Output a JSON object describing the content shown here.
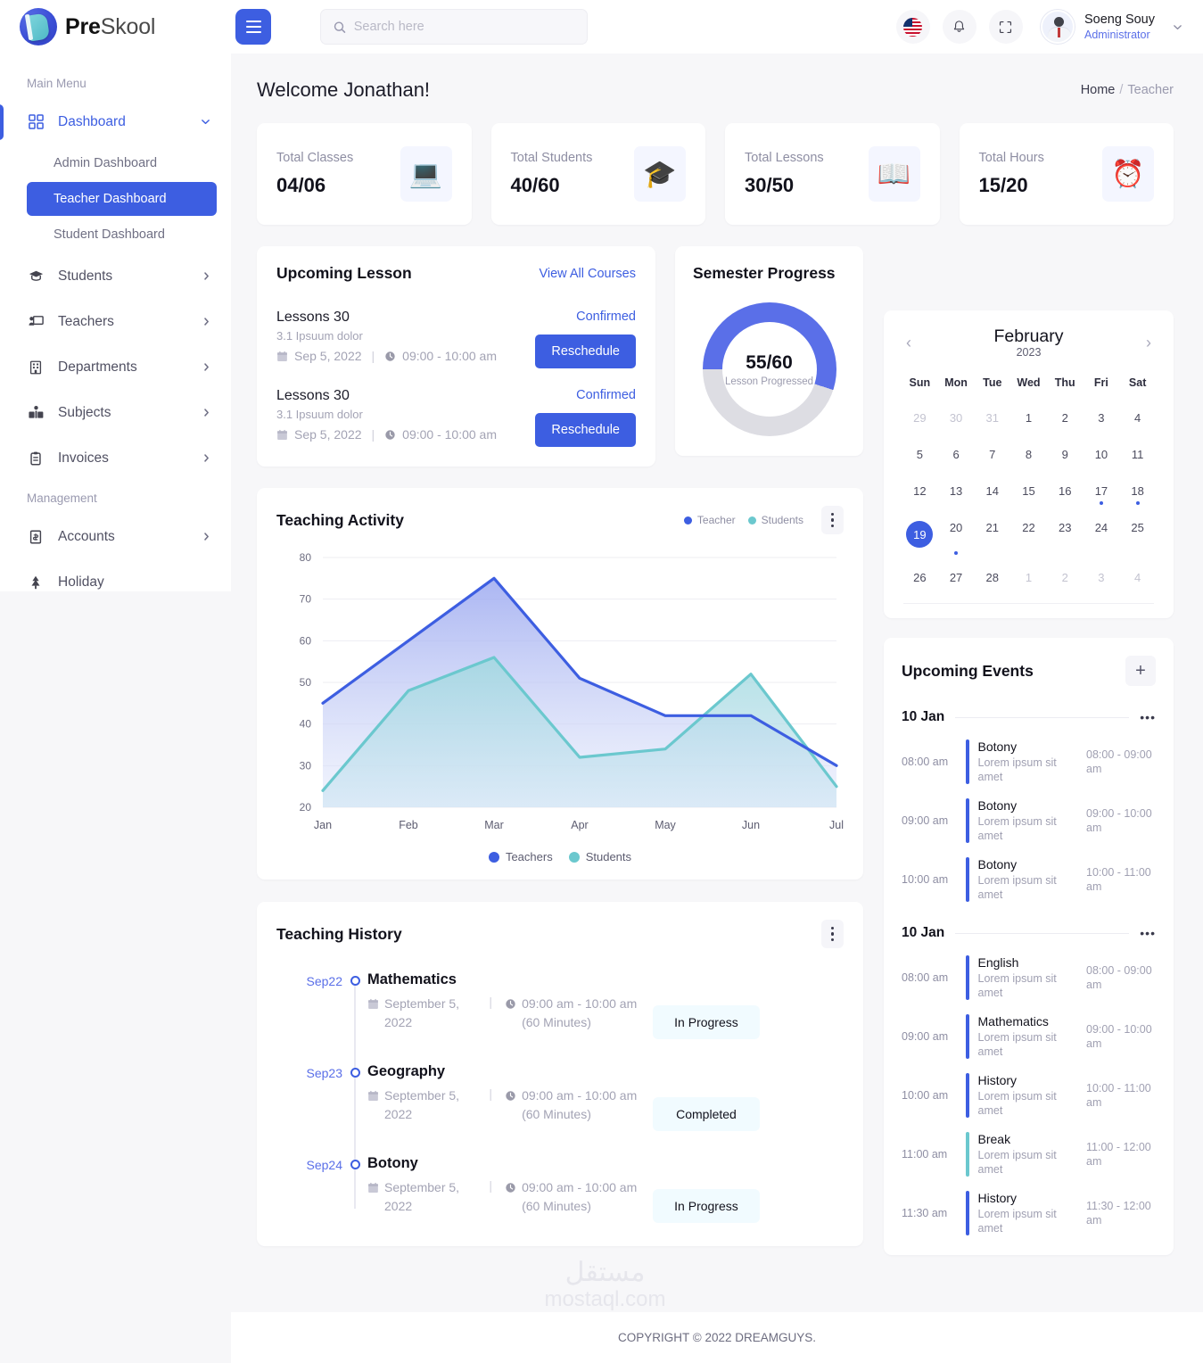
{
  "brand": {
    "pre": "Pre",
    "skool": "Skool"
  },
  "header": {
    "search_placeholder": "Search here",
    "search_value": "",
    "profile": {
      "name": "Soeng Souy",
      "role": "Administrator"
    },
    "icons": {
      "flag": "us-flag-icon",
      "bell": "bell-icon",
      "scan": "fullscreen-icon"
    }
  },
  "sidebar": {
    "main_label": "Main Menu",
    "management_label": "Management",
    "dashboard": {
      "label": "Dashboard"
    },
    "sub_items": [
      {
        "label": "Admin Dashboard",
        "selected": false
      },
      {
        "label": "Teacher Dashboard",
        "selected": true
      },
      {
        "label": "Student Dashboard",
        "selected": false
      }
    ],
    "items": [
      {
        "label": "Students"
      },
      {
        "label": "Teachers"
      },
      {
        "label": "Departments"
      },
      {
        "label": "Subjects"
      },
      {
        "label": "Invoices"
      }
    ],
    "management_items": [
      {
        "label": "Accounts"
      },
      {
        "label": "Holiday"
      }
    ]
  },
  "page": {
    "welcome": "Welcome Jonathan!",
    "breadcrumb": {
      "home": "Home",
      "sep": "/",
      "current": "Teacher"
    }
  },
  "stats": [
    {
      "title": "Total Classes",
      "value": "04/06",
      "icon": "💻"
    },
    {
      "title": "Total Students",
      "value": "40/60",
      "icon": "🎓"
    },
    {
      "title": "Total Lessons",
      "value": "30/50",
      "icon": "📖"
    },
    {
      "title": "Total Hours",
      "value": "15/20",
      "icon": "⏰"
    }
  ],
  "upcoming_lesson": {
    "title": "Upcoming Lesson",
    "view_all": "View All Courses",
    "lessons": [
      {
        "name": "Lessons 30",
        "sub": "3.1 Ipsuum dolor",
        "date": "Sep 5, 2022",
        "time": "09:00 - 10:00 am",
        "status": "Confirmed",
        "action": "Reschedule"
      },
      {
        "name": "Lessons 30",
        "sub": "3.1 Ipsuum dolor",
        "date": "Sep 5, 2022",
        "time": "09:00 - 10:00 am",
        "status": "Confirmed",
        "action": "Reschedule"
      }
    ]
  },
  "semester_progress": {
    "title": "Semester Progress",
    "value": "55/60",
    "label": "Lesson Progressed",
    "percent": 55,
    "color": "#5A6FE8",
    "track_color": "#DDDDE3"
  },
  "calendar": {
    "month": "February",
    "year": "2023",
    "prev": "‹",
    "next": "›",
    "dow": [
      "Sun",
      "Mon",
      "Tue",
      "Wed",
      "Thu",
      "Fri",
      "Sat"
    ],
    "weeks": [
      [
        {
          "d": "29",
          "muted": true
        },
        {
          "d": "30",
          "muted": true
        },
        {
          "d": "31",
          "muted": true
        },
        {
          "d": "1"
        },
        {
          "d": "2"
        },
        {
          "d": "3"
        },
        {
          "d": "4"
        }
      ],
      [
        {
          "d": "5"
        },
        {
          "d": "6"
        },
        {
          "d": "7"
        },
        {
          "d": "8"
        },
        {
          "d": "9"
        },
        {
          "d": "10"
        },
        {
          "d": "11"
        }
      ],
      [
        {
          "d": "12"
        },
        {
          "d": "13"
        },
        {
          "d": "14"
        },
        {
          "d": "15"
        },
        {
          "d": "16"
        },
        {
          "d": "17",
          "dot": true
        },
        {
          "d": "18",
          "dot": true
        }
      ],
      [
        {
          "d": "19",
          "today": true
        },
        {
          "d": "20",
          "dot": true
        },
        {
          "d": "21"
        },
        {
          "d": "22"
        },
        {
          "d": "23"
        },
        {
          "d": "24"
        },
        {
          "d": "25"
        }
      ],
      [
        {
          "d": "26"
        },
        {
          "d": "27"
        },
        {
          "d": "28"
        },
        {
          "d": "1",
          "muted": true
        },
        {
          "d": "2",
          "muted": true
        },
        {
          "d": "3",
          "muted": true
        },
        {
          "d": "4",
          "muted": true
        }
      ]
    ]
  },
  "upcoming_events": {
    "title": "Upcoming Events",
    "add": "+",
    "dots": "•••",
    "groups": [
      {
        "date": "10 Jan",
        "items": [
          {
            "time": "08:00 am",
            "title": "Botony",
            "desc": "Lorem ipsum sit amet",
            "range": "08:00 - 09:00 am",
            "color": "blue"
          },
          {
            "time": "09:00 am",
            "title": "Botony",
            "desc": "Lorem ipsum sit amet",
            "range": "09:00 - 10:00 am",
            "color": "blue"
          },
          {
            "time": "10:00 am",
            "title": "Botony",
            "desc": "Lorem ipsum sit amet",
            "range": "10:00 - 11:00 am",
            "color": "blue"
          }
        ]
      },
      {
        "date": "10 Jan",
        "items": [
          {
            "time": "08:00 am",
            "title": "English",
            "desc": "Lorem ipsum sit amet",
            "range": "08:00 - 09:00 am",
            "color": "blue"
          },
          {
            "time": "09:00 am",
            "title": "Mathematics",
            "desc": "Lorem ipsum sit amet",
            "range": "09:00 - 10:00 am",
            "color": "blue"
          },
          {
            "time": "10:00 am",
            "title": "History",
            "desc": "Lorem ipsum sit amet",
            "range": "10:00 - 11:00 am",
            "color": "blue"
          },
          {
            "time": "11:00 am",
            "title": "Break",
            "desc": "Lorem ipsum sit amet",
            "range": "11:00 - 12:00 am",
            "color": "teal"
          },
          {
            "time": "11:30 am",
            "title": "History",
            "desc": "Lorem ipsum sit amet",
            "range": "11:30 - 12:00 am",
            "color": "blue"
          }
        ]
      }
    ]
  },
  "teaching_activity": {
    "title": "Teaching Activity",
    "legend_top": [
      {
        "label": "Teacher",
        "color": "#3D5EE1"
      },
      {
        "label": "Students",
        "color": "#6BC8CE"
      }
    ],
    "legend_bottom": [
      {
        "label": "Teachers",
        "color": "#3D5EE1"
      },
      {
        "label": "Students",
        "color": "#6BC8CE"
      }
    ]
  },
  "chart_data": {
    "type": "area",
    "title": "Teaching Activity",
    "xlabel": "",
    "ylabel": "",
    "categories": [
      "Jan",
      "Feb",
      "Mar",
      "Apr",
      "May",
      "Jun",
      "Jul"
    ],
    "yticks": [
      20,
      30,
      40,
      50,
      60,
      70,
      80
    ],
    "ylim": [
      20,
      80
    ],
    "grid": true,
    "legend_position": "bottom",
    "series": [
      {
        "name": "Teachers",
        "color": "#3D5EE1",
        "values": [
          45,
          60,
          75,
          51,
          42,
          42,
          30
        ]
      },
      {
        "name": "Students",
        "color": "#6BC8CE",
        "values": [
          24,
          48,
          56,
          32,
          34,
          52,
          25
        ]
      }
    ]
  },
  "teaching_history": {
    "title": "Teaching History",
    "items": [
      {
        "date": "Sep22",
        "subject": "Mathematics",
        "day": "September 5, 2022",
        "time": "09:00 am - 10:00 am (60 Minutes)",
        "status": "In Progress"
      },
      {
        "date": "Sep23",
        "subject": "Geography",
        "day": "September 5, 2022",
        "time": "09:00 am - 10:00 am (60 Minutes)",
        "status": "Completed"
      },
      {
        "date": "Sep24",
        "subject": "Botony",
        "day": "September 5, 2022",
        "time": "09:00 am - 10:00 am (60 Minutes)",
        "status": "In Progress"
      }
    ]
  },
  "footer": {
    "copyright": "COPYRIGHT © 2022 DREAMGUYS."
  },
  "watermark": {
    "arabic": "مستقل",
    "latin": "mostaql.com"
  }
}
